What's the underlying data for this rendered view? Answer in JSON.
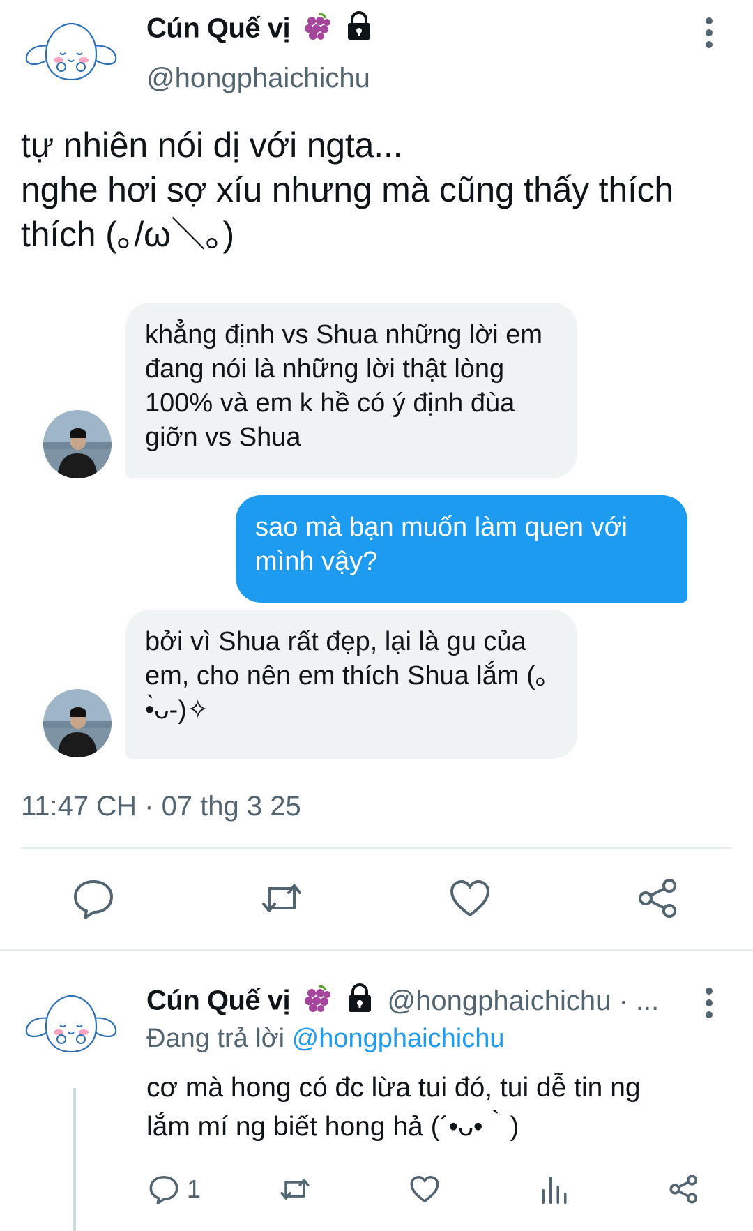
{
  "tweet": {
    "display_name": "Cún Quế vị",
    "handle": "@hongphaichichu",
    "text": "tự nhiên nói dị với ngta...\nnghe hơi sợ xíu nhưng mà cũng thấy thích thích (｡/ω＼｡)",
    "timestamp": "11:47 CH · 07 thg 3 25",
    "icons": {
      "avatar": "cinnamoroll-dog-avatar",
      "emoji_1": "grapes-emoji",
      "emoji_2": "lock-icon",
      "more": "more-vertical-icon"
    }
  },
  "chat": {
    "messages": [
      {
        "side": "in",
        "text": "khẳng định vs Shua những lời em đang nói là những lời thật lòng 100% và em k hề có ý định đùa giỡn vs Shua"
      },
      {
        "side": "out",
        "text": "sao mà bạn muốn làm quen với mình vậy?"
      },
      {
        "side": "in",
        "text": "bởi vì Shua rất đẹp, lại là gu của em, cho nên em thích Shua lắm (｡•̀ᴗ-)✧"
      }
    ]
  },
  "actions": {
    "reply_icon": "reply-icon",
    "retweet_icon": "retweet-icon",
    "like_icon": "heart-icon",
    "share_icon": "share-icon"
  },
  "reply": {
    "display_name": "Cún Quế vị",
    "handle_meta": "@hongphaichichu · ...",
    "replying_prefix": "Đang trả lời ",
    "replying_mention": "@hongphaichichu",
    "text": "cơ mà hong có đc lừa tui đó, tui dễ tin ng\nlắm mí ng biết hong hả (´•ᴗ•｀)",
    "reply_count": "1"
  },
  "colors": {
    "accent": "#1d9bf0",
    "muted": "#536471",
    "bubble_in": "#eff3f4"
  }
}
